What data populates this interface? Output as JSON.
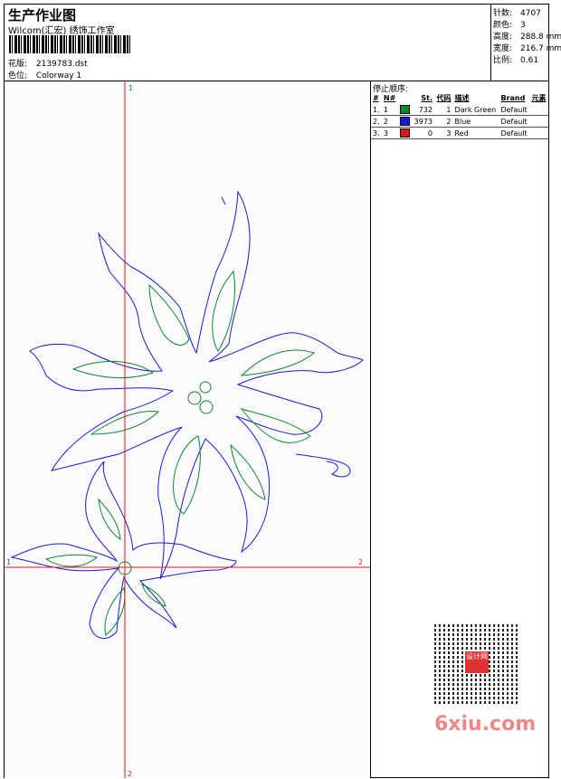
{
  "header": {
    "title": "生产作业图",
    "studio": "Wilcom(汇宏) 绣饰工作室",
    "design_label": "花版:",
    "design_value": "2139783.dst",
    "color_label": "色位:",
    "color_value": "Colorway 1"
  },
  "stats": {
    "stitches_label": "针数:",
    "stitches": "4707",
    "colors_label": "颜色:",
    "colors": "3",
    "height_label": "高度:",
    "height": "288.8 mm",
    "width_label": "宽度:",
    "width": "216.7 mm",
    "scale_label": "比例:",
    "scale": "0.61"
  },
  "axis_labels": {
    "top": "1",
    "left": "1",
    "right": "2",
    "bottom": "2"
  },
  "stop_sequence": {
    "heading": "停止顺序:",
    "columns": [
      "#",
      "N#",
      "",
      "St.",
      "代码",
      "描述",
      "Brand",
      "元素"
    ],
    "rows": [
      {
        "idx": "1.",
        "n": "1",
        "color": "#0a8a2a",
        "st": "732",
        "code": "1",
        "desc": "Dark Green",
        "brand": "Default",
        "element": ""
      },
      {
        "idx": "2.",
        "n": "2",
        "color": "#1a1ad6",
        "st": "3973",
        "code": "2",
        "desc": "Blue",
        "brand": "Default",
        "element": ""
      },
      {
        "idx": "3.",
        "n": "3",
        "color": "#e01616",
        "st": "0",
        "code": "3",
        "desc": "Red",
        "brand": "Default",
        "element": ""
      }
    ]
  },
  "watermark": {
    "text": "6xiu.com",
    "stamp": "设计网"
  },
  "colors": {
    "outline": "#1a1ad6",
    "fill": "#0a8a2a",
    "axis": "#e01616",
    "axis_label": "#0a8a2a"
  }
}
